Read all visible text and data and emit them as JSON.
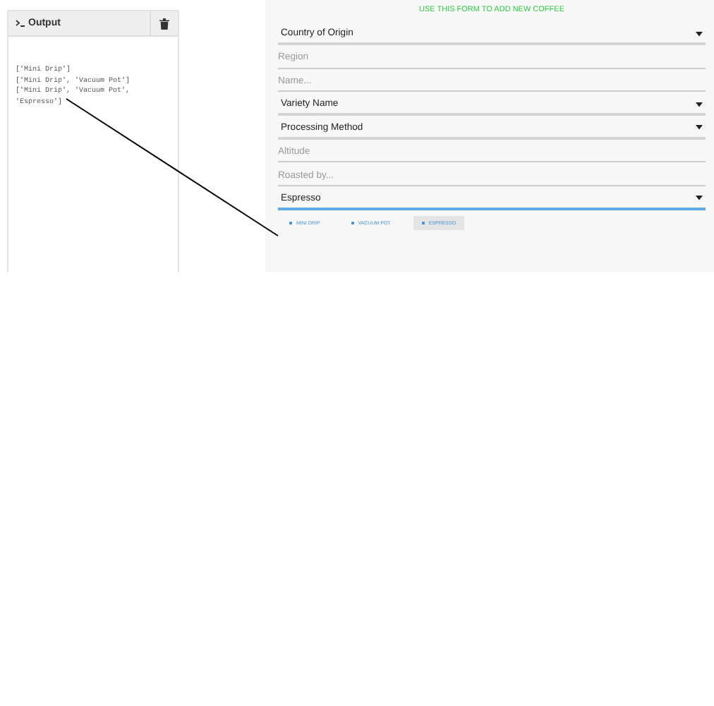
{
  "output_panel": {
    "title": "Output",
    "lines": [
      "['Mini Drip']",
      "['Mini Drip', 'Vacuum Pot']",
      "['Mini Drip', 'Vacuum Pot',",
      "'Espresso']"
    ]
  },
  "form": {
    "heading": "USE THIS FORM TO ADD NEW COFFEE",
    "fields": [
      {
        "kind": "select",
        "text": "Country of Origin",
        "focused": false
      },
      {
        "kind": "input",
        "placeholder": "Region",
        "focused": false
      },
      {
        "kind": "input",
        "placeholder": "Name...",
        "focused": false
      },
      {
        "kind": "select",
        "text": "Variety Name",
        "focused": false
      },
      {
        "kind": "select",
        "text": "Processing Method",
        "focused": false
      },
      {
        "kind": "input",
        "placeholder": "Altitude",
        "focused": false
      },
      {
        "kind": "input",
        "placeholder": "Roasted by...",
        "focused": false
      },
      {
        "kind": "select",
        "text": "Espresso",
        "focused": true
      }
    ],
    "brew_methods": [
      {
        "label": "MINI DRIP",
        "selected": false
      },
      {
        "label": "VACUUM POT",
        "selected": false
      },
      {
        "label": "ESPRESSO",
        "selected": true
      }
    ]
  }
}
